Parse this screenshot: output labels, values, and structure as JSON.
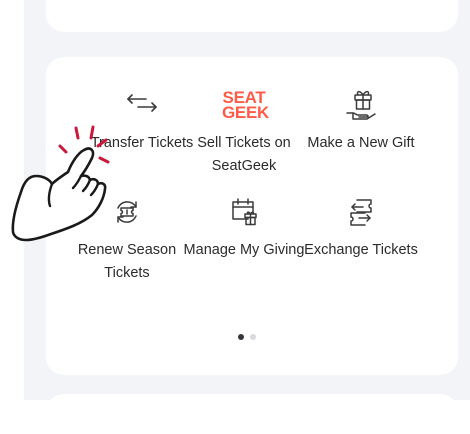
{
  "actions": [
    {
      "label": "Transfer Tickets",
      "icon": "transfer-arrows-icon"
    },
    {
      "label": "Sell Tickets on SeatGeek",
      "icon": "seatgeek-logo",
      "logo_line1": "SEAT",
      "logo_line2": "GEEK"
    },
    {
      "label": "Make a New Gift",
      "icon": "gift-hand-icon"
    },
    {
      "label": "Renew Season Tickets",
      "icon": "renew-ticket-icon"
    },
    {
      "label": "Manage My Giving",
      "icon": "calendar-gift-icon"
    },
    {
      "label": "Exchange Tickets",
      "icon": "exchange-tickets-icon"
    }
  ],
  "pagination": {
    "pages": 2,
    "current": 1
  },
  "colors": {
    "brand": "#ff5b49",
    "text": "#2b2b2b",
    "icon": "#3a3a3a",
    "background": "#f3f4f7",
    "tap_indicator": "#c9193c"
  }
}
